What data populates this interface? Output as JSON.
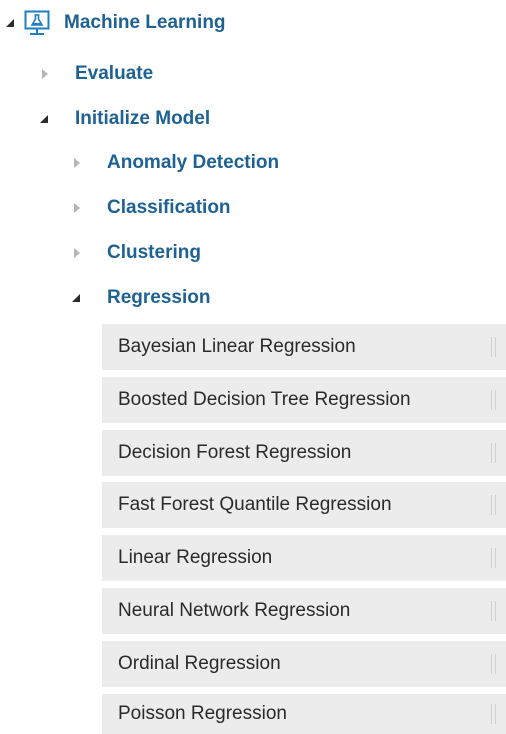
{
  "tree": {
    "root": {
      "label": "Machine Learning",
      "icon": "flask-monitor-icon",
      "expanded": true
    },
    "level1": [
      {
        "label": "Evaluate",
        "expanded": false
      },
      {
        "label": "Initialize Model",
        "expanded": true
      }
    ],
    "level2": [
      {
        "label": "Anomaly Detection",
        "expanded": false
      },
      {
        "label": "Classification",
        "expanded": false
      },
      {
        "label": "Clustering",
        "expanded": false
      },
      {
        "label": "Regression",
        "expanded": true
      }
    ],
    "modules": [
      {
        "label": "Bayesian Linear Regression"
      },
      {
        "label": "Boosted Decision Tree Regression"
      },
      {
        "label": "Decision Forest Regression"
      },
      {
        "label": "Fast Forest Quantile Regression"
      },
      {
        "label": "Linear Regression"
      },
      {
        "label": "Neural Network Regression"
      },
      {
        "label": "Ordinal Regression"
      },
      {
        "label": "Poisson Regression"
      }
    ]
  },
  "colors": {
    "category_text": "#1e6193",
    "module_bg": "#ececec",
    "module_text": "#2a2a2a",
    "icon_accent": "#1f7fc0"
  }
}
